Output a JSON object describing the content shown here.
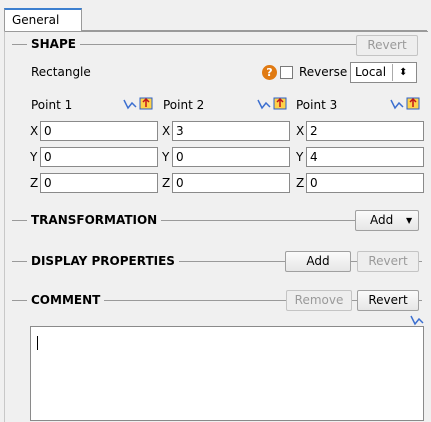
{
  "tabs": [
    {
      "label": "General"
    }
  ],
  "shape": {
    "section_title": "SHAPE",
    "revert_label": "Revert",
    "shape_name": "Rectangle",
    "help_label": "?",
    "reverse_label": "Reverse",
    "coord_system": "Local",
    "points": [
      {
        "label": "Point 1",
        "x": "0",
        "y": "0",
        "z": "0"
      },
      {
        "label": "Point 2",
        "x": "3",
        "y": "0",
        "z": "0"
      },
      {
        "label": "Point 3",
        "x": "2",
        "y": "4",
        "z": "0"
      }
    ],
    "axis_labels": {
      "x": "X",
      "y": "Y",
      "z": "Z"
    }
  },
  "transformation": {
    "section_title": "TRANSFORMATION",
    "add_label": "Add"
  },
  "display_properties": {
    "section_title": "DISPLAY PROPERTIES",
    "add_label": "Add",
    "revert_label": "Revert"
  },
  "comment": {
    "section_title": "COMMENT",
    "remove_label": "Remove",
    "revert_label": "Revert",
    "text": ""
  },
  "colors": {
    "tab_accent": "#3c7fcf",
    "help_badge": "#e07a12",
    "graph_icon": "#3c6fd0"
  }
}
